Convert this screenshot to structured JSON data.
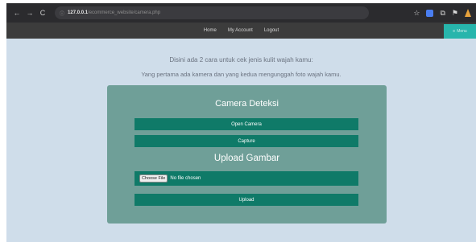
{
  "browser": {
    "nav_icons": {
      "back": "←",
      "forward": "→",
      "reload": "C"
    },
    "url_host": "127.0.0.1",
    "url_path": "/ecommerce_website/camera.php",
    "icons": [
      "star-icon",
      "extension-icon",
      "puzzle-icon",
      "profile-icon"
    ]
  },
  "nav": {
    "home": "Home",
    "account": "My Account",
    "logout": "Logout",
    "widget_icon": "≡",
    "widget_label": "Menu"
  },
  "intro": {
    "line1": "Disini ada 2 cara untuk cek jenis kulit wajah kamu:",
    "line2": "Yang pertama ada kamera dan yang kedua mengunggah foto wajah kamu."
  },
  "camera": {
    "title": "Camera Deteksi",
    "open_label": "Open Camera",
    "capture_label": "Capture"
  },
  "upload": {
    "title": "Upload Gambar",
    "choose_label": "Choose File",
    "file_status": "No file chosen",
    "upload_label": "Upload"
  },
  "colors": {
    "page_bg": "#cfddea",
    "card_bg": "#6f9f98",
    "button_bg": "#0f7a68",
    "nav_bg": "#3c3c3c",
    "accent_teal": "#27b5ac"
  }
}
